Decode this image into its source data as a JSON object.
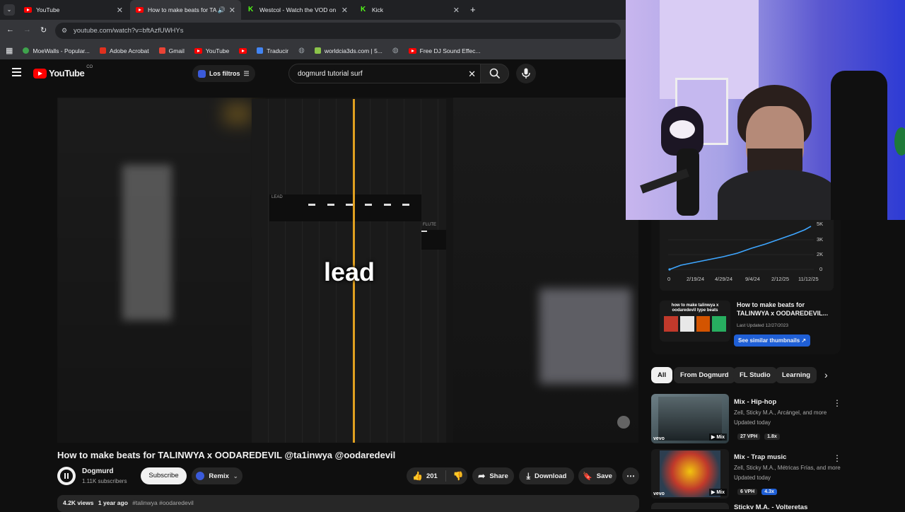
{
  "browser": {
    "tabs": [
      {
        "label": "YouTube",
        "icon": "youtube-favicon"
      },
      {
        "label": "How to make beats for TAL",
        "icon": "youtube-favicon"
      },
      {
        "label": "Westcol - Watch the VOD on Ki",
        "icon": "kick-favicon"
      },
      {
        "label": "Kick",
        "icon": "kick-favicon"
      }
    ],
    "url": "youtube.com/watch?v=bftAzfUWHYs",
    "bookmarks": [
      {
        "label": "MoeWalls - Popular...",
        "color": "#3fa34d"
      },
      {
        "label": "Adobe Acrobat",
        "color": "#e0301e"
      },
      {
        "label": "Gmail",
        "color": "#ea4335"
      },
      {
        "label": "YouTube",
        "color": "#ff0000"
      },
      {
        "label": "",
        "color": "#ff0000"
      },
      {
        "label": "Traducir",
        "color": "#4285f4"
      },
      {
        "label": "",
        "color": "#9aa0a6"
      },
      {
        "label": "worldcia3ds.com | 5...",
        "color": "#8bc34a"
      },
      {
        "label": "",
        "color": "#9aa0a6"
      },
      {
        "label": "Free DJ Sound Effec...",
        "color": "#ff0000"
      }
    ]
  },
  "youtube": {
    "logo": "YouTube",
    "country": "CO",
    "filters_label": "Los filtros",
    "search_query": "dogmurd tutorial surf"
  },
  "video": {
    "caption": "lead",
    "lead_label": "LEAD",
    "flute_label": "FLUTE",
    "title": "How to make beats for TALINWYA x OODAREDEVIL @ta1inwya @oodaredevil",
    "channel": "Dogmurd",
    "subscribers": "1.11K subscribers",
    "subscribe_label": "Subscribe",
    "remix_label": "Remix",
    "likes": "201",
    "share_label": "Share",
    "download_label": "Download",
    "save_label": "Save",
    "views": "4.2K views",
    "age": "1 year ago",
    "tags": "#talinwya #oodaredevil"
  },
  "analytics": {
    "y_ticks": [
      "5K",
      "3K",
      "2K",
      "0"
    ],
    "x_ticks": [
      "0",
      "2/19/24",
      "4/29/24",
      "9/4/24",
      "2/12/25",
      "11/12/25"
    ],
    "card_title": "How to make beats for TALINWYA x OODAREDEVIL...",
    "last_updated": "Last Updated 12/27/2023",
    "thumb_text": "how to make talinwya x oodaredevil type beats",
    "similar_label": "See similar thumbnails ↗"
  },
  "chips": [
    "All",
    "From Dogmurd",
    "FL Studio",
    "Learning"
  ],
  "related": [
    {
      "title": "Mix - Hip-hop",
      "artists": "Zell, Sticky M.A., Arcángel, and more",
      "updated": "Updated today",
      "badge1": "27 VPH",
      "badge2": "1.8x",
      "mix_label": "Mix"
    },
    {
      "title": "Mix - Trap music",
      "artists": "Zell, Sticky M.A., Métricas Frías, and more",
      "updated": "Updated today",
      "badge1": "6 VPH",
      "badge2": "4.3x",
      "mix_label": "Mix"
    },
    {
      "title": "Sticky M.A. - Volteretas"
    }
  ],
  "colors": {
    "accent": "#ff0000",
    "link_blue": "#065fd4",
    "kick_green": "#53fc18",
    "playhead": "#e0a020"
  }
}
